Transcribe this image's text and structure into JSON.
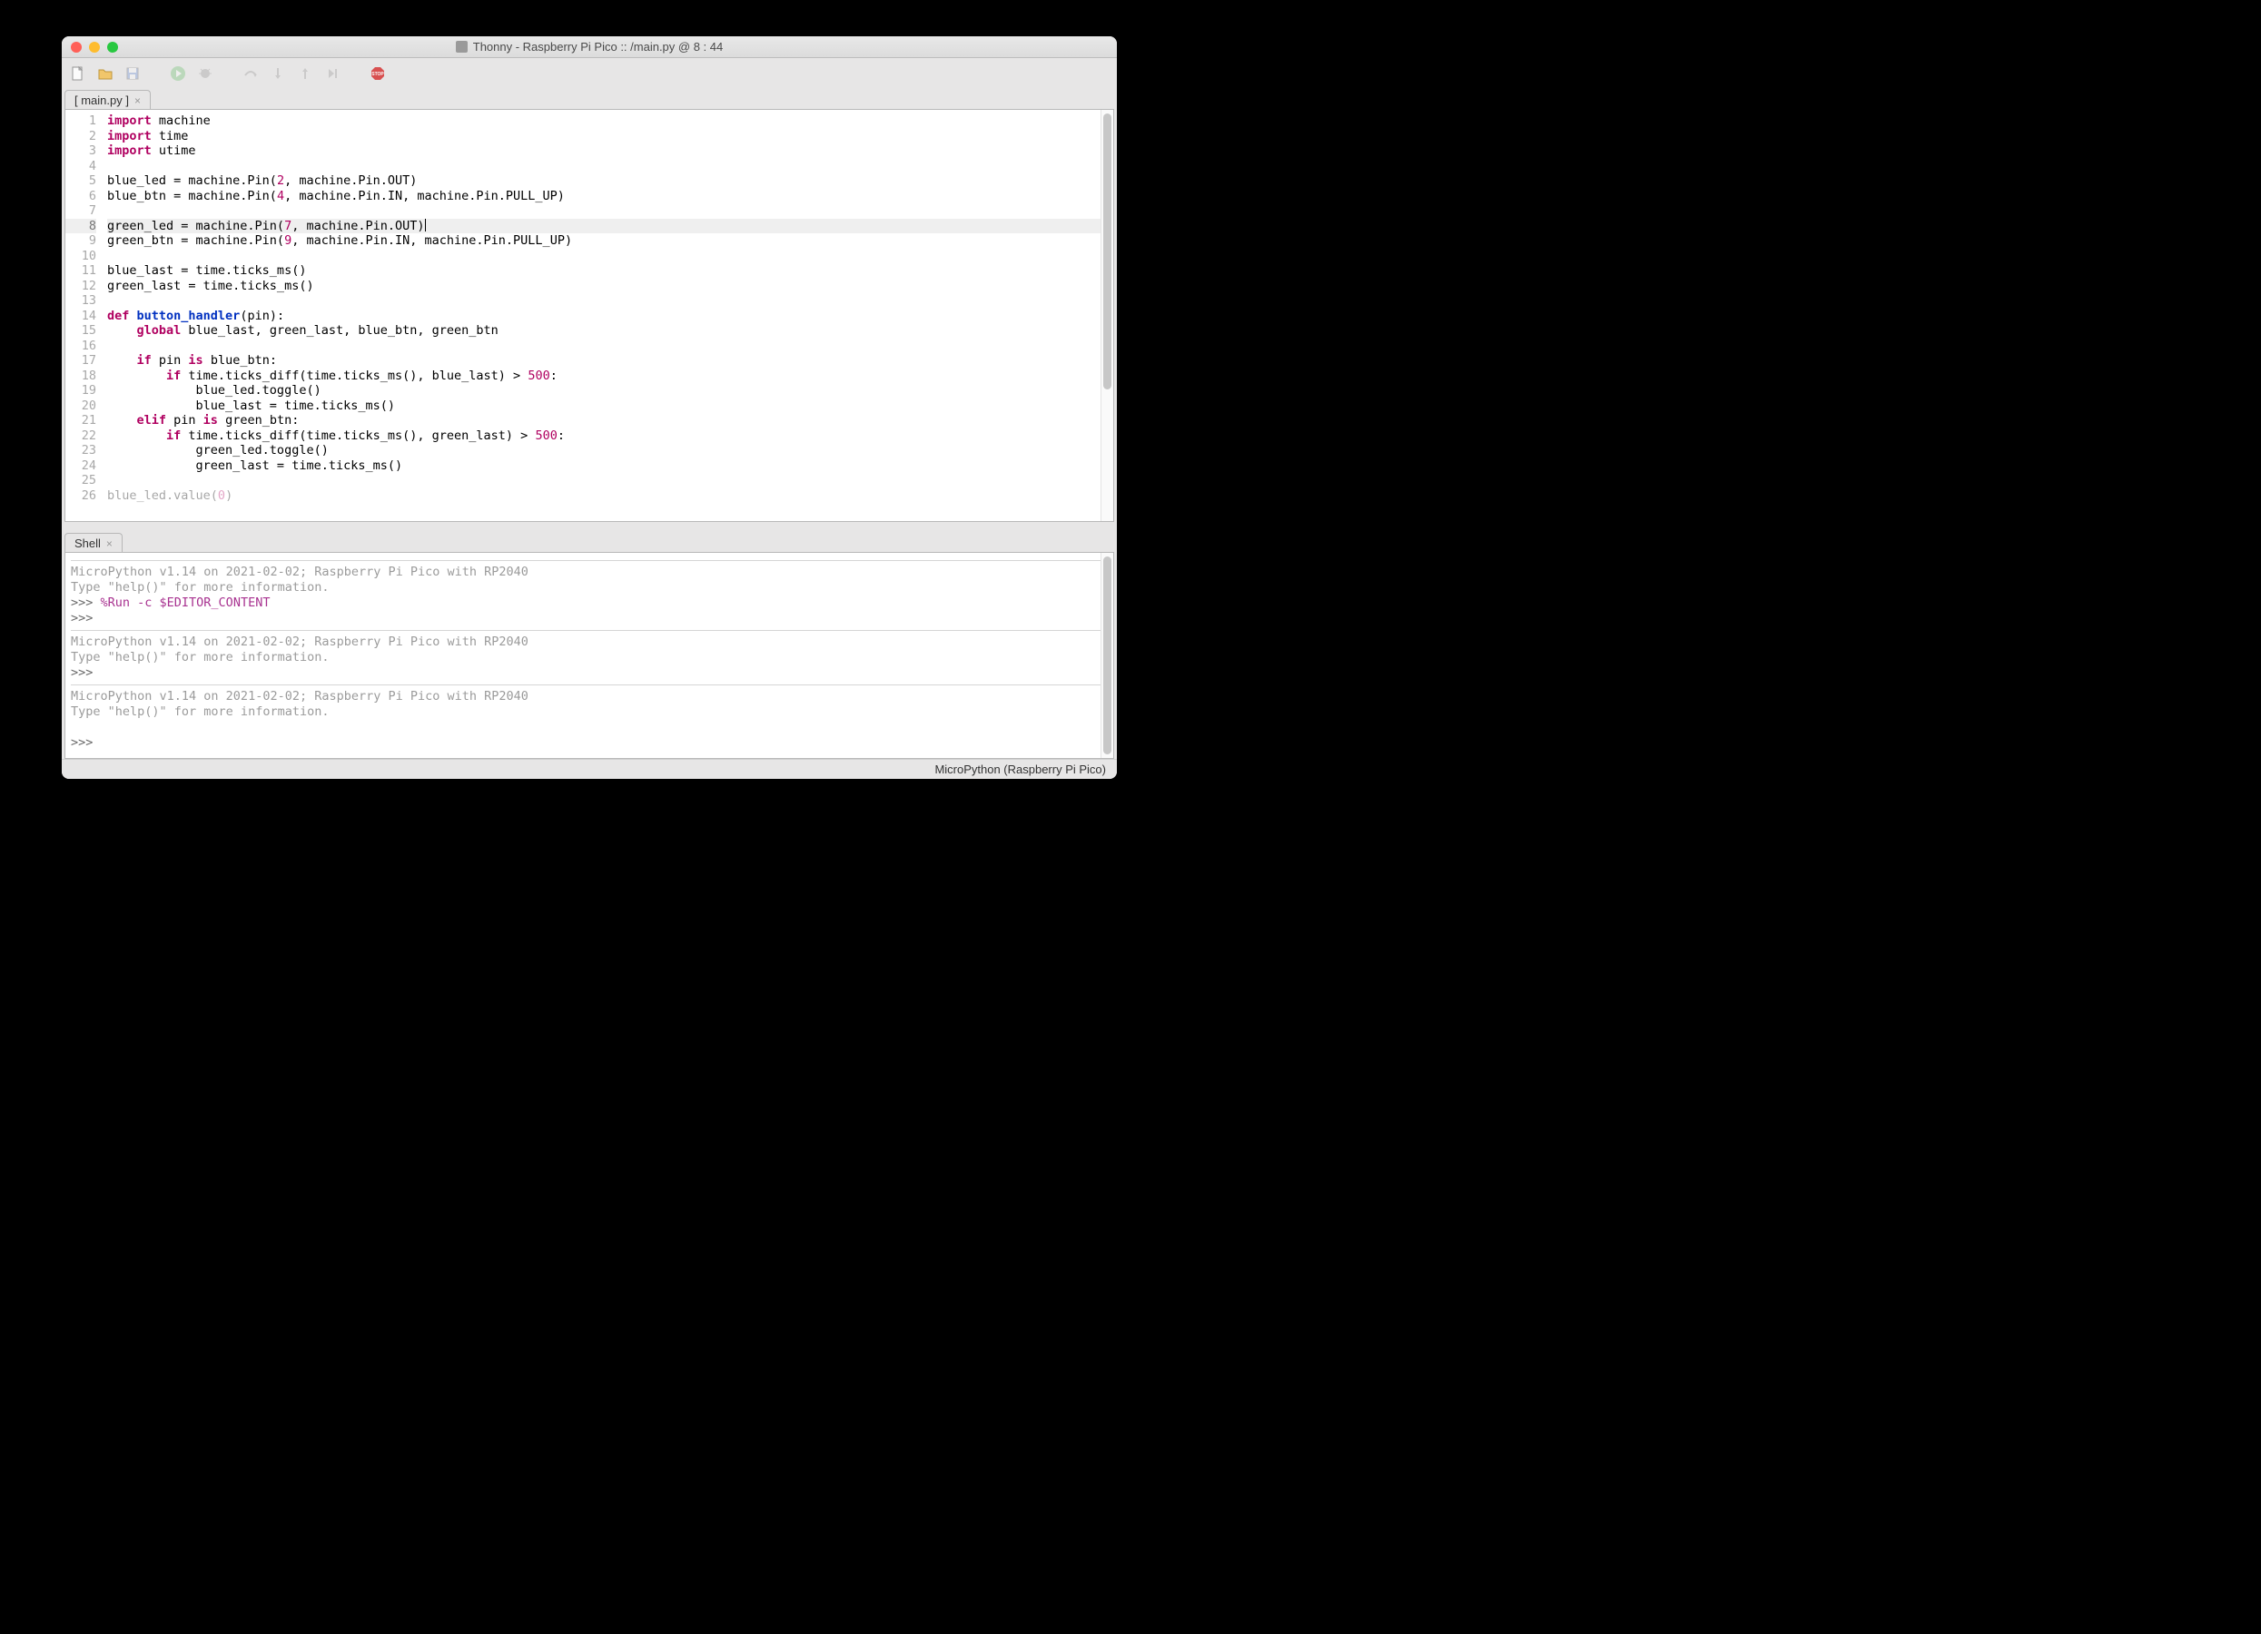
{
  "window": {
    "title": "Thonny  -  Raspberry Pi Pico :: /main.py  @  8 : 44"
  },
  "toolbar": {
    "new": "New",
    "open": "Open",
    "save": "Save",
    "run": "Run",
    "debug": "Debug",
    "step_over": "Step over",
    "step_into": "Step into",
    "step_out": "Step out",
    "resume": "Resume",
    "stop": "Stop"
  },
  "tabs": {
    "editor": "[ main.py ]",
    "shell": "Shell"
  },
  "editor": {
    "current_line": 8,
    "line_count": 26,
    "lines": [
      {
        "n": 1,
        "segs": [
          {
            "t": "import",
            "c": "kw"
          },
          {
            "t": " machine"
          }
        ]
      },
      {
        "n": 2,
        "segs": [
          {
            "t": "import",
            "c": "kw"
          },
          {
            "t": " time"
          }
        ]
      },
      {
        "n": 3,
        "segs": [
          {
            "t": "import",
            "c": "kw"
          },
          {
            "t": " utime"
          }
        ]
      },
      {
        "n": 4,
        "segs": []
      },
      {
        "n": 5,
        "segs": [
          {
            "t": "blue_led = machine.Pin("
          },
          {
            "t": "2",
            "c": "num"
          },
          {
            "t": ", machine.Pin.OUT)"
          }
        ]
      },
      {
        "n": 6,
        "segs": [
          {
            "t": "blue_btn = machine.Pin("
          },
          {
            "t": "4",
            "c": "num"
          },
          {
            "t": ", machine.Pin.IN, machine.Pin.PULL_UP)"
          }
        ]
      },
      {
        "n": 7,
        "segs": []
      },
      {
        "n": 8,
        "segs": [
          {
            "t": "green_led = machine.Pin("
          },
          {
            "t": "7",
            "c": "num"
          },
          {
            "t": ", machine.Pin.OUT)"
          }
        ],
        "cursor": true
      },
      {
        "n": 9,
        "segs": [
          {
            "t": "green_btn = machine.Pin("
          },
          {
            "t": "9",
            "c": "num"
          },
          {
            "t": ", machine.Pin.IN, machine.Pin.PULL_UP)"
          }
        ]
      },
      {
        "n": 10,
        "segs": []
      },
      {
        "n": 11,
        "segs": [
          {
            "t": "blue_last = time.ticks_ms()"
          }
        ]
      },
      {
        "n": 12,
        "segs": [
          {
            "t": "green_last = time.ticks_ms()"
          }
        ]
      },
      {
        "n": 13,
        "segs": []
      },
      {
        "n": 14,
        "segs": [
          {
            "t": "def ",
            "c": "kw"
          },
          {
            "t": "button_handler",
            "c": "fn"
          },
          {
            "t": "(pin):"
          }
        ]
      },
      {
        "n": 15,
        "segs": [
          {
            "t": "    "
          },
          {
            "t": "global",
            "c": "kw"
          },
          {
            "t": " blue_last, green_last, blue_btn, green_btn"
          }
        ]
      },
      {
        "n": 16,
        "segs": []
      },
      {
        "n": 17,
        "segs": [
          {
            "t": "    "
          },
          {
            "t": "if",
            "c": "kw"
          },
          {
            "t": " pin "
          },
          {
            "t": "is",
            "c": "kw"
          },
          {
            "t": " blue_btn:"
          }
        ]
      },
      {
        "n": 18,
        "segs": [
          {
            "t": "        "
          },
          {
            "t": "if",
            "c": "kw"
          },
          {
            "t": " time.ticks_diff(time.ticks_ms(), blue_last) > "
          },
          {
            "t": "500",
            "c": "num"
          },
          {
            "t": ":"
          }
        ]
      },
      {
        "n": 19,
        "segs": [
          {
            "t": "            blue_led.toggle()"
          }
        ]
      },
      {
        "n": 20,
        "segs": [
          {
            "t": "            blue_last = time.ticks_ms()"
          }
        ]
      },
      {
        "n": 21,
        "segs": [
          {
            "t": "    "
          },
          {
            "t": "elif",
            "c": "kw"
          },
          {
            "t": " pin "
          },
          {
            "t": "is",
            "c": "kw"
          },
          {
            "t": " green_btn:"
          }
        ]
      },
      {
        "n": 22,
        "segs": [
          {
            "t": "        "
          },
          {
            "t": "if",
            "c": "kw"
          },
          {
            "t": " time.ticks_diff(time.ticks_ms(), green_last) > "
          },
          {
            "t": "500",
            "c": "num"
          },
          {
            "t": ":"
          }
        ]
      },
      {
        "n": 23,
        "segs": [
          {
            "t": "            green_led.toggle()"
          }
        ]
      },
      {
        "n": 24,
        "segs": [
          {
            "t": "            green_last = time.ticks_ms()"
          }
        ]
      },
      {
        "n": 25,
        "segs": []
      },
      {
        "n": 26,
        "segs": [
          {
            "t": "blue_led.value("
          },
          {
            "t": "0",
            "c": "num"
          },
          {
            "t": ")"
          }
        ],
        "partial": true
      }
    ]
  },
  "shell": {
    "blocks": [
      {
        "lines": [
          {
            "segs": [
              {
                "t": "MicroPython v1.14 on 2021-02-02; Raspberry Pi Pico with RP2040",
                "c": "shell-gray"
              }
            ]
          },
          {
            "segs": [
              {
                "t": "Type \"help()\" for more information.",
                "c": "shell-gray"
              }
            ]
          },
          {
            "segs": [
              {
                "t": ">>> ",
                "c": "shell-prompt"
              },
              {
                "t": "%Run -c $EDITOR_CONTENT",
                "c": "shell-mag"
              }
            ]
          },
          {
            "segs": [
              {
                "t": ">>> ",
                "c": "shell-prompt"
              }
            ]
          }
        ]
      },
      {
        "lines": [
          {
            "segs": [
              {
                "t": "MicroPython v1.14 on 2021-02-02; Raspberry Pi Pico with RP2040",
                "c": "shell-gray"
              }
            ]
          },
          {
            "segs": [
              {
                "t": "Type \"help()\" for more information.",
                "c": "shell-gray"
              }
            ]
          },
          {
            "segs": [
              {
                "t": ">>> ",
                "c": "shell-prompt"
              }
            ]
          }
        ]
      },
      {
        "lines": [
          {
            "segs": [
              {
                "t": "MicroPython v1.14 on 2021-02-02; Raspberry Pi Pico with RP2040",
                "c": "shell-gray"
              }
            ]
          },
          {
            "segs": [
              {
                "t": "Type \"help()\" for more information.",
                "c": "shell-gray"
              }
            ]
          },
          {
            "segs": [
              {
                "t": ""
              }
            ]
          },
          {
            "segs": [
              {
                "t": ">>> ",
                "c": "shell-prompt"
              }
            ]
          }
        ]
      }
    ]
  },
  "statusbar": {
    "interpreter": "MicroPython (Raspberry Pi Pico)"
  }
}
